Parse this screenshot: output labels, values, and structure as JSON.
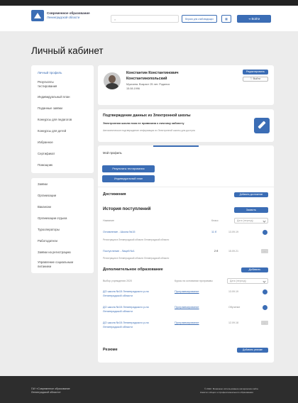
{
  "header": {
    "logo_line1": "Современное образование",
    "logo_line2": "Ленинградской области",
    "search_placeholder": "",
    "btn_special": "Версия для слабовидящих",
    "btn_grid": "",
    "btn_login": "Войти"
  },
  "page_title": "Личный кабинет",
  "sidebar1": [
    "Личный профиль",
    "Результаты тестирования",
    "Индивидуальный план",
    "Поданные заявки",
    "Конкурсы для педагогов",
    "Конкурсы для детей",
    "Избранное",
    "Сертификат",
    "Помощник"
  ],
  "sidebar2": [
    "Заявки",
    "Организации",
    "Вакансии",
    "Организации отдыха",
    "Турооператоры",
    "Работодатели",
    "Заявки на регистрацию",
    "Управление социальным питанием"
  ],
  "profile": {
    "name": "Константин Константинович Константинопольский",
    "sub1": "Мужчина. Возраст 25 лет. Родился",
    "sub2": "15.08.1996",
    "btn_edit": "Редактировать",
    "btn_other": "Выйти"
  },
  "confirm": {
    "title": "Подтверждение данных из Электронной школы",
    "text1": "Электронная школа пока не привязана к личному кабинету",
    "text2": "Автоматическое подтверждение информации из Электронной школы для доступа"
  },
  "my_profile": {
    "label": "Мой профиль",
    "btn1": "Результаты тестирования",
    "btn2": "Индивидуальный план"
  },
  "achievements": {
    "title": "Достижения",
    "btn": "Добавить достижение"
  },
  "history": {
    "title": "История поступлений",
    "btn": "Заявить",
    "col1": "Название",
    "col2": "Класс",
    "filter": "Дата (период)",
    "rows": [
      {
        "name": "Оглавление - Школа №15",
        "sub": "Регистрация в Ленинградской области Ленинградской области",
        "cls": "11 б",
        "date": "13.09.19"
      },
      {
        "name": "Поступление - Лицей №1",
        "sub": "Регистрация в Ленинградской области Ленинградской области",
        "cls": "2 б",
        "date": "15.09.21"
      }
    ]
  },
  "extra": {
    "title": "Дополнительное образование",
    "btn": "Добавить",
    "col1": "Выбор учреждения 2020",
    "col2": "Курсы на основании программы",
    "filter": "Дата (период)",
    "rows": [
      {
        "name": "ДО школа №15 Ленинградского р-на",
        "name2": "Ленинградской области",
        "prog": "Программирование",
        "date": "13.09.19"
      },
      {
        "name": "ДО школа №15 Ленинградского р-на",
        "name2": "Ленинградской области",
        "prog": "Программирование",
        "date": "Обучение"
      },
      {
        "name": "ДО школа №15 Ленинградского р-на",
        "name2": "Ленинградской области",
        "prog": "Программирование",
        "date": "12.09.18"
      }
    ]
  },
  "resume": {
    "title": "Резюме",
    "btn": "Добавить резюме"
  },
  "footer": {
    "left1": "ГАУ «Современное образование",
    "left2": "Ленинградской области»",
    "right1": "© 2022. Возможно использование материалов сайта",
    "right2": "Комитет общего и профессионального образования"
  }
}
